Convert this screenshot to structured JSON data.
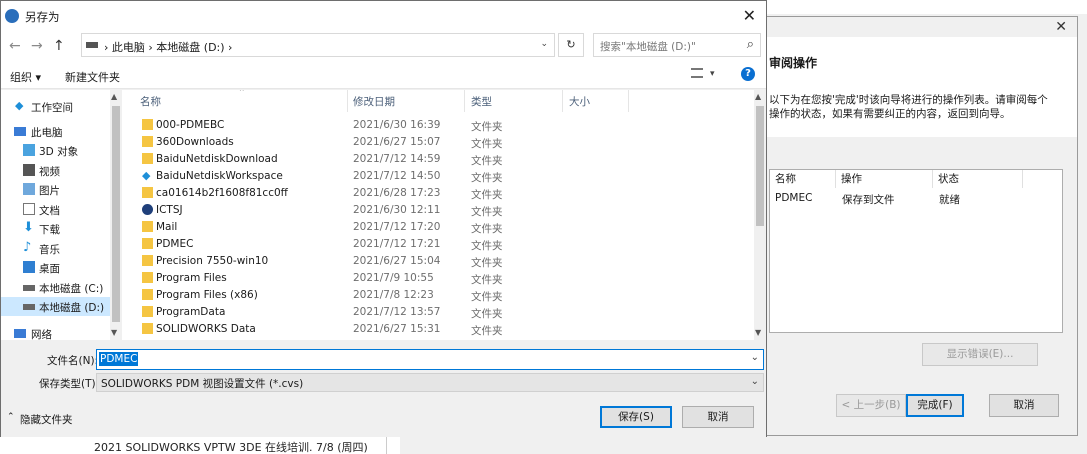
{
  "background": {
    "bottom_text": "2021 SOLIDWORKS VPTW 3DE 在线培训.     7/8 (周四)"
  },
  "wizard": {
    "close_icon": "close-icon",
    "title": "审阅操作",
    "description": "以下为在您按'完成'时该向导将进行的操作列表。请审阅每个操作的状态，如果有需要纠正的内容，返回到向导。",
    "columns": [
      "名称",
      "操作",
      "状态"
    ],
    "row": [
      "PDMEC",
      "保存到文件",
      "就绪"
    ],
    "show_errors": "显示错误(E)...",
    "back": "< 上一步(B)",
    "finish": "完成(F)",
    "cancel": "取消"
  },
  "dialog": {
    "title": "另存为",
    "nav": {
      "back": "←",
      "forward": "→",
      "up": "↑"
    },
    "breadcrumb": "›  此电脑  ›  本地磁盘 (D:)  ›",
    "refresh": "↻",
    "search_placeholder": "搜索\"本地磁盘 (D:)\"",
    "toolbar": {
      "organize": "组织 ▾",
      "new_folder": "新建文件夹",
      "help": "?"
    },
    "nav_items": [
      {
        "label": "工作空间",
        "icon": "workspace-icon"
      },
      {
        "label": "此电脑",
        "icon": "computer-icon"
      },
      {
        "label": "3D 对象",
        "icon": "3d-objects-icon"
      },
      {
        "label": "视频",
        "icon": "video-icon"
      },
      {
        "label": "图片",
        "icon": "pictures-icon"
      },
      {
        "label": "文档",
        "icon": "documents-icon"
      },
      {
        "label": "下载",
        "icon": "download-icon"
      },
      {
        "label": "音乐",
        "icon": "music-icon"
      },
      {
        "label": "桌面",
        "icon": "desktop-icon"
      },
      {
        "label": "本地磁盘 (C:)",
        "icon": "drive-icon"
      },
      {
        "label": "本地磁盘 (D:)",
        "icon": "drive-icon"
      },
      {
        "label": "网络",
        "icon": "network-icon"
      }
    ],
    "columns": [
      "名称",
      "修改日期",
      "类型",
      "大小"
    ],
    "files": [
      {
        "name": "000-PDMEBC",
        "date": "2021/6/30 16:39",
        "type": "文件夹",
        "icon": "folder-icon"
      },
      {
        "name": "360Downloads",
        "date": "2021/6/27 15:07",
        "type": "文件夹",
        "icon": "folder-icon"
      },
      {
        "name": "BaiduNetdiskDownload",
        "date": "2021/7/12 14:59",
        "type": "文件夹",
        "icon": "folder-icon"
      },
      {
        "name": "BaiduNetdiskWorkspace",
        "date": "2021/7/12 14:50",
        "type": "文件夹",
        "icon": "workspace-icon"
      },
      {
        "name": "ca01614b2f1608f81cc0ff",
        "date": "2021/6/28 17:23",
        "type": "文件夹",
        "icon": "folder-icon"
      },
      {
        "name": "ICTSJ",
        "date": "2021/6/30 12:11",
        "type": "文件夹",
        "icon": "vault-icon"
      },
      {
        "name": "Mail",
        "date": "2021/7/12 17:20",
        "type": "文件夹",
        "icon": "folder-icon"
      },
      {
        "name": "PDMEC",
        "date": "2021/7/12 17:21",
        "type": "文件夹",
        "icon": "folder-icon"
      },
      {
        "name": "Precision 7550-win10",
        "date": "2021/6/27 15:04",
        "type": "文件夹",
        "icon": "folder-icon"
      },
      {
        "name": "Program Files",
        "date": "2021/7/9 10:55",
        "type": "文件夹",
        "icon": "folder-icon"
      },
      {
        "name": "Program Files (x86)",
        "date": "2021/7/8 12:23",
        "type": "文件夹",
        "icon": "folder-icon"
      },
      {
        "name": "ProgramData",
        "date": "2021/7/12 13:57",
        "type": "文件夹",
        "icon": "folder-icon"
      },
      {
        "name": "SOLIDWORKS Data",
        "date": "2021/6/27 15:31",
        "type": "文件夹",
        "icon": "folder-icon"
      }
    ],
    "filename_label": "文件名(N):",
    "filename_value": "PDMEC",
    "filetype_label": "保存类型(T):",
    "filetype_value": "SOLIDWORKS PDM 视图设置文件 (*.cvs)",
    "hide_folders": "隐藏文件夹",
    "save": "保存(S)",
    "cancel": "取消"
  },
  "colors": {
    "accent": "#0078d7",
    "folder": "#f5c542",
    "selection": "#cce8ff"
  }
}
